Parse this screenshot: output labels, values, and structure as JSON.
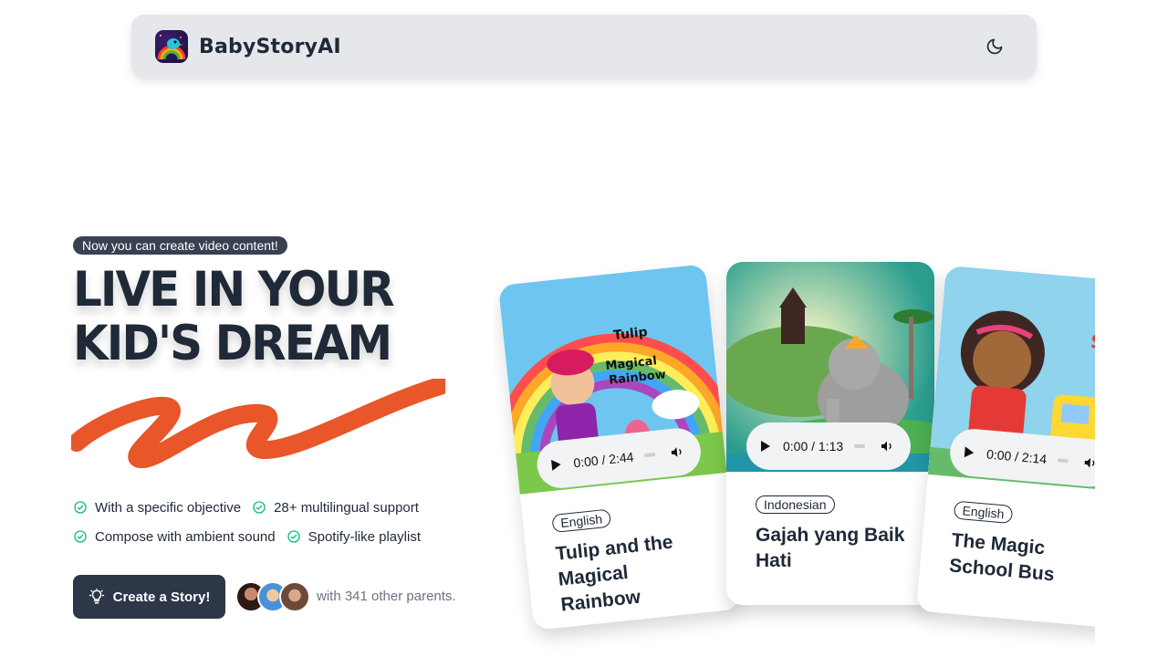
{
  "navbar": {
    "brand": "BabyStoryAI",
    "logo_icon": "rainbow-bird-logo",
    "theme_icon": "moon-icon"
  },
  "hero": {
    "badge": " Now you can create video content!",
    "headline_line1": "Live in your",
    "headline_line2": "kid's dream",
    "accent_color": "#e8562a",
    "features": [
      {
        "label": "With a specific objective",
        "icon": "check-circle-icon"
      },
      {
        "label": "28+ multilingual support",
        "icon": "check-circle-icon"
      },
      {
        "label": "Compose with ambient sound",
        "icon": "check-circle-icon"
      },
      {
        "label": "Spotify-like playlist",
        "icon": "check-circle-icon"
      }
    ],
    "check_color": "#10b981",
    "cta_label": "Create a Story!",
    "cta_icon": "lightbulb-icon",
    "social_proof": "with 341 other parents."
  },
  "stories": [
    {
      "title": "Tulip and the Magical Rainbow",
      "language": "English",
      "time": "0:00 / 2:44",
      "image_text": "Tulip and the Magical Rainbow"
    },
    {
      "title": "Gajah yang Baik Hati",
      "language": "Indonesian",
      "time": "0:00 / 1:13"
    },
    {
      "title": "The Magic School Bus",
      "language": "English",
      "time": "0:00 / 2:14",
      "image_text": "The Magic School Bus"
    }
  ]
}
